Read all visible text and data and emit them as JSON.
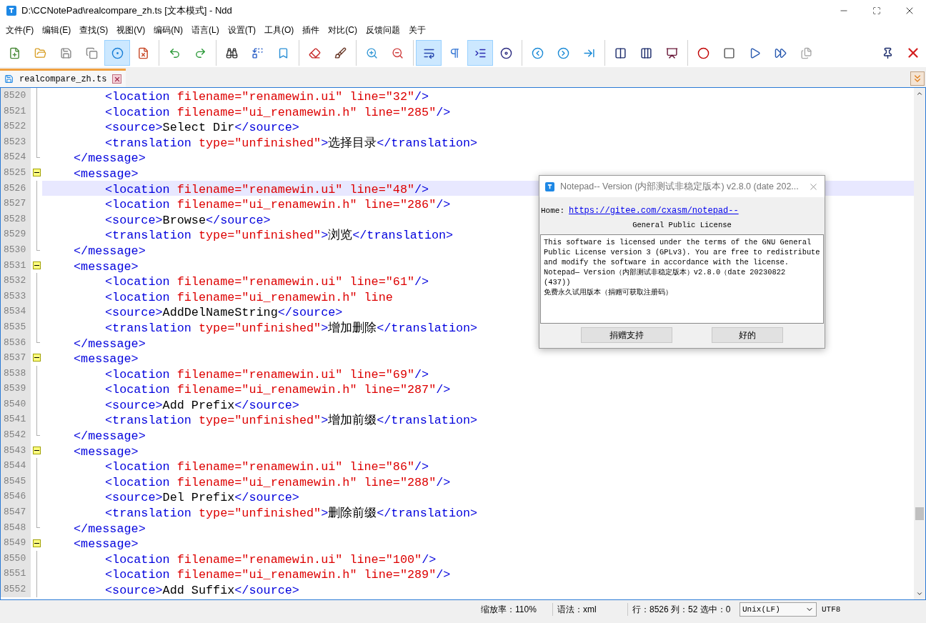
{
  "window": {
    "title": "D:\\CCNotePad\\realcompare_zh.ts [文本模式] - Ndd"
  },
  "menu": [
    "文件(F)",
    "编辑(E)",
    "查找(S)",
    "视图(V)",
    "编码(N)",
    "语言(L)",
    "设置(T)",
    "工具(O)",
    "插件",
    "对比(C)",
    "反馈问题",
    "关于"
  ],
  "toolbar": [
    [
      {
        "on": false
      },
      {
        "on": false
      },
      {
        "on": false
      },
      {
        "on": false
      },
      {
        "on": true
      },
      {
        "on": false
      }
    ],
    [
      {
        "on": false
      },
      {
        "on": false
      }
    ],
    [
      {
        "on": false
      },
      {
        "on": false
      },
      {
        "on": false
      }
    ],
    [
      {
        "on": false
      },
      {
        "on": false
      }
    ],
    [
      {
        "on": false
      },
      {
        "on": false
      }
    ],
    [
      {
        "on": true
      },
      {
        "on": false
      },
      {
        "on": true
      },
      {
        "on": false
      }
    ],
    [
      {
        "on": false
      },
      {
        "on": false
      },
      {
        "on": false
      }
    ],
    [
      {
        "on": false
      },
      {
        "on": false
      },
      {
        "on": false
      }
    ],
    [
      {
        "on": false
      },
      {
        "on": false
      },
      {
        "on": false
      },
      {
        "on": false
      },
      {
        "on": false
      }
    ]
  ],
  "tabs": [
    {
      "label": "realcompare_zh.ts",
      "selected": true
    }
  ],
  "editor": {
    "lines": [
      {
        "number": "8520",
        "kind": "inner",
        "selected": false,
        "tokens": [
          {
            "kind": "tag",
            "text": "<location "
          },
          {
            "kind": "attr",
            "text": "filename=\"renamewin.ui\" line=\"32\""
          },
          {
            "kind": "tag",
            "text": "/>"
          }
        ]
      },
      {
        "number": "8521",
        "kind": "inner",
        "selected": false,
        "tokens": [
          {
            "kind": "tag",
            "text": "<location "
          },
          {
            "kind": "attr",
            "text": "filename=\"ui_renamewin.h\" line=\"285\""
          },
          {
            "kind": "tag",
            "text": "/>"
          }
        ]
      },
      {
        "number": "8522",
        "kind": "inner",
        "selected": false,
        "tokens": [
          {
            "kind": "tag",
            "text": "<source>"
          },
          {
            "kind": "text",
            "text": "Select Dir"
          },
          {
            "kind": "tag",
            "text": "</source>"
          }
        ]
      },
      {
        "number": "8523",
        "kind": "inner",
        "selected": false,
        "tokens": [
          {
            "kind": "tag",
            "text": "<translation "
          },
          {
            "kind": "attr",
            "text": "type=\"unfinished\""
          },
          {
            "kind": "tag",
            "text": ">"
          },
          {
            "kind": "text",
            "text": "选择目录"
          },
          {
            "kind": "tag",
            "text": "</translation>"
          }
        ]
      },
      {
        "number": "8524",
        "kind": "close",
        "selected": false,
        "tokens": [
          {
            "kind": "tag",
            "text": "</message>"
          }
        ]
      },
      {
        "number": "8525",
        "kind": "open",
        "selected": false,
        "tokens": [
          {
            "kind": "tag",
            "text": "<message>"
          }
        ]
      },
      {
        "number": "8526",
        "kind": "inner",
        "selected": true,
        "tokens": [
          {
            "kind": "tag",
            "text": "<location "
          },
          {
            "kind": "attr",
            "text": "filename=\"renamewin.ui\" line=\"48\""
          },
          {
            "kind": "tag",
            "text": "/>"
          }
        ]
      },
      {
        "number": "8527",
        "kind": "inner",
        "selected": false,
        "tokens": [
          {
            "kind": "tag",
            "text": "<location "
          },
          {
            "kind": "attr",
            "text": "filename=\"ui_renamewin.h\" line=\"286\""
          },
          {
            "kind": "tag",
            "text": "/>"
          }
        ]
      },
      {
        "number": "8528",
        "kind": "inner",
        "selected": false,
        "tokens": [
          {
            "kind": "tag",
            "text": "<source>"
          },
          {
            "kind": "text",
            "text": "Browse"
          },
          {
            "kind": "tag",
            "text": "</source>"
          }
        ]
      },
      {
        "number": "8529",
        "kind": "inner",
        "selected": false,
        "tokens": [
          {
            "kind": "tag",
            "text": "<translation "
          },
          {
            "kind": "attr",
            "text": "type=\"unfinished\""
          },
          {
            "kind": "tag",
            "text": ">"
          },
          {
            "kind": "text",
            "text": "浏览"
          },
          {
            "kind": "tag",
            "text": "</translation>"
          }
        ]
      },
      {
        "number": "8530",
        "kind": "close",
        "selected": false,
        "tokens": [
          {
            "kind": "tag",
            "text": "</message>"
          }
        ]
      },
      {
        "number": "8531",
        "kind": "open",
        "selected": false,
        "tokens": [
          {
            "kind": "tag",
            "text": "<message>"
          }
        ]
      },
      {
        "number": "8532",
        "kind": "inner",
        "selected": false,
        "tokens": [
          {
            "kind": "tag",
            "text": "<location "
          },
          {
            "kind": "attr",
            "text": "filename=\"renamewin.ui\" line=\"61\""
          },
          {
            "kind": "tag",
            "text": "/>"
          }
        ]
      },
      {
        "number": "8533",
        "kind": "inner",
        "selected": false,
        "tokens": [
          {
            "kind": "tag",
            "text": "<location "
          },
          {
            "kind": "attr",
            "text": "filename=\"ui_renamewin.h\" line"
          }
        ]
      },
      {
        "number": "8534",
        "kind": "inner",
        "selected": false,
        "tokens": [
          {
            "kind": "tag",
            "text": "<source>"
          },
          {
            "kind": "text",
            "text": "AddDelNameString"
          },
          {
            "kind": "tag",
            "text": "</source>"
          }
        ]
      },
      {
        "number": "8535",
        "kind": "inner",
        "selected": false,
        "tokens": [
          {
            "kind": "tag",
            "text": "<translation "
          },
          {
            "kind": "attr",
            "text": "type=\"unfinished\""
          },
          {
            "kind": "tag",
            "text": ">"
          },
          {
            "kind": "text",
            "text": "增加删除"
          },
          {
            "kind": "tag",
            "text": "</translation>"
          }
        ]
      },
      {
        "number": "8536",
        "kind": "close",
        "selected": false,
        "tokens": [
          {
            "kind": "tag",
            "text": "</message>"
          }
        ]
      },
      {
        "number": "8537",
        "kind": "open",
        "selected": false,
        "tokens": [
          {
            "kind": "tag",
            "text": "<message>"
          }
        ]
      },
      {
        "number": "8538",
        "kind": "inner",
        "selected": false,
        "tokens": [
          {
            "kind": "tag",
            "text": "<location "
          },
          {
            "kind": "attr",
            "text": "filename=\"renamewin.ui\" line=\"69\""
          },
          {
            "kind": "tag",
            "text": "/>"
          }
        ]
      },
      {
        "number": "8539",
        "kind": "inner",
        "selected": false,
        "tokens": [
          {
            "kind": "tag",
            "text": "<location "
          },
          {
            "kind": "attr",
            "text": "filename=\"ui_renamewin.h\" line=\"287\""
          },
          {
            "kind": "tag",
            "text": "/>"
          }
        ]
      },
      {
        "number": "8540",
        "kind": "inner",
        "selected": false,
        "tokens": [
          {
            "kind": "tag",
            "text": "<source>"
          },
          {
            "kind": "text",
            "text": "Add Prefix"
          },
          {
            "kind": "tag",
            "text": "</source>"
          }
        ]
      },
      {
        "number": "8541",
        "kind": "inner",
        "selected": false,
        "tokens": [
          {
            "kind": "tag",
            "text": "<translation "
          },
          {
            "kind": "attr",
            "text": "type=\"unfinished\""
          },
          {
            "kind": "tag",
            "text": ">"
          },
          {
            "kind": "text",
            "text": "增加前缀"
          },
          {
            "kind": "tag",
            "text": "</translation>"
          }
        ]
      },
      {
        "number": "8542",
        "kind": "close",
        "selected": false,
        "tokens": [
          {
            "kind": "tag",
            "text": "</message>"
          }
        ]
      },
      {
        "number": "8543",
        "kind": "open",
        "selected": false,
        "tokens": [
          {
            "kind": "tag",
            "text": "<message>"
          }
        ]
      },
      {
        "number": "8544",
        "kind": "inner",
        "selected": false,
        "tokens": [
          {
            "kind": "tag",
            "text": "<location "
          },
          {
            "kind": "attr",
            "text": "filename=\"renamewin.ui\" line=\"86\""
          },
          {
            "kind": "tag",
            "text": "/>"
          }
        ]
      },
      {
        "number": "8545",
        "kind": "inner",
        "selected": false,
        "tokens": [
          {
            "kind": "tag",
            "text": "<location "
          },
          {
            "kind": "attr",
            "text": "filename=\"ui_renamewin.h\" line=\"288\""
          },
          {
            "kind": "tag",
            "text": "/>"
          }
        ]
      },
      {
        "number": "8546",
        "kind": "inner",
        "selected": false,
        "tokens": [
          {
            "kind": "tag",
            "text": "<source>"
          },
          {
            "kind": "text",
            "text": "Del Prefix"
          },
          {
            "kind": "tag",
            "text": "</source>"
          }
        ]
      },
      {
        "number": "8547",
        "kind": "inner",
        "selected": false,
        "tokens": [
          {
            "kind": "tag",
            "text": "<translation "
          },
          {
            "kind": "attr",
            "text": "type=\"unfinished\""
          },
          {
            "kind": "tag",
            "text": ">"
          },
          {
            "kind": "text",
            "text": "删除前缀"
          },
          {
            "kind": "tag",
            "text": "</translation>"
          }
        ]
      },
      {
        "number": "8548",
        "kind": "close",
        "selected": false,
        "tokens": [
          {
            "kind": "tag",
            "text": "</message>"
          }
        ]
      },
      {
        "number": "8549",
        "kind": "open",
        "selected": false,
        "tokens": [
          {
            "kind": "tag",
            "text": "<message>"
          }
        ]
      },
      {
        "number": "8550",
        "kind": "inner",
        "selected": false,
        "tokens": [
          {
            "kind": "tag",
            "text": "<location "
          },
          {
            "kind": "attr",
            "text": "filename=\"renamewin.ui\" line=\"100\""
          },
          {
            "kind": "tag",
            "text": "/>"
          }
        ]
      },
      {
        "number": "8551",
        "kind": "inner",
        "selected": false,
        "tokens": [
          {
            "kind": "tag",
            "text": "<location "
          },
          {
            "kind": "attr",
            "text": "filename=\"ui_renamewin.h\" line=\"289\""
          },
          {
            "kind": "tag",
            "text": "/>"
          }
        ]
      },
      {
        "number": "8552",
        "kind": "inner",
        "selected": false,
        "tokens": [
          {
            "kind": "tag",
            "text": "<source>"
          },
          {
            "kind": "text",
            "text": "Add Suffix"
          },
          {
            "kind": "tag",
            "text": "</source>"
          }
        ]
      }
    ]
  },
  "dialog": {
    "title": "Notepad-- Version (内部测试非稳定版本) v2.8.0 (date 202...",
    "home_label": "Home:",
    "home_link": "https://gitee.com/cxasm/notepad--",
    "heading": "General Public License",
    "license_lines": [
      "This software is licensed under the terms of the GNU General",
      "Public License version 3 (GPLv3). You are free to redistribute",
      "and modify the software in accordance with the license.",
      "Notepad— Version（内部测试非稳定版本）v2.8.0（date 20230822",
      "(437))",
      "免费永久试用版本（捐赠可获取注册码）"
    ],
    "buttons": [
      "捐赠支持",
      "好的"
    ]
  },
  "status_bar": {
    "zoom": "缩放率：110%",
    "syntax": "语法：xml",
    "position": "行：8526 列：52 选中：0",
    "line_ending": "Unix(LF)",
    "encoding": "UTF8"
  }
}
